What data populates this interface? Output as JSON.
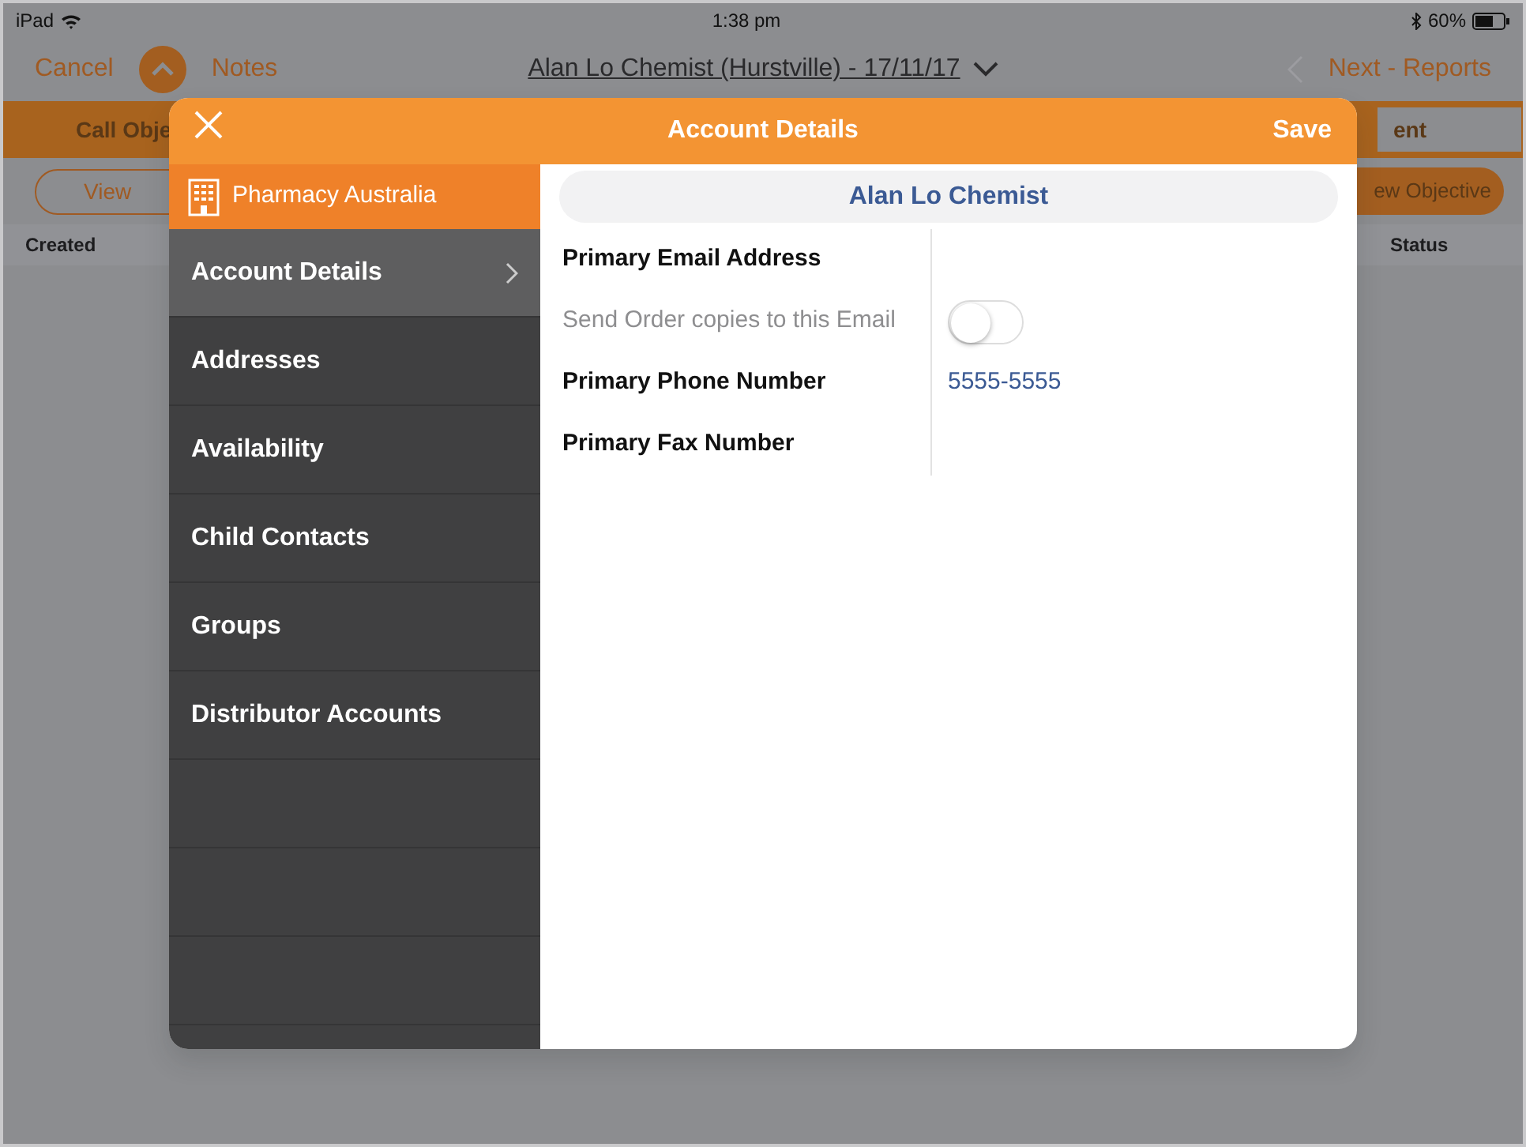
{
  "status_bar": {
    "device": "iPad",
    "time": "1:38 pm",
    "battery": "60%"
  },
  "nav": {
    "cancel": "Cancel",
    "notes": "Notes",
    "title": "Alan Lo Chemist (Hurstville) - 17/11/17",
    "next": "Next - Reports"
  },
  "tabs": [
    {
      "label": "Call Obje",
      "selected": true
    },
    {
      "label": "ent",
      "selected": false
    }
  ],
  "toolbar": {
    "view": "View",
    "new_objective": "ew Objective"
  },
  "table": {
    "columns": [
      "Created",
      "Status"
    ]
  },
  "modal": {
    "title": "Account Details",
    "save": "Save",
    "sidebar": {
      "header": "Pharmacy Australia",
      "items": [
        {
          "label": "Account Details",
          "selected": true
        },
        {
          "label": "Addresses",
          "selected": false
        },
        {
          "label": "Availability",
          "selected": false
        },
        {
          "label": "Child Contacts",
          "selected": false
        },
        {
          "label": "Groups",
          "selected": false
        },
        {
          "label": "Distributor Accounts",
          "selected": false
        }
      ]
    },
    "account_name": "Alan Lo Chemist",
    "fields": [
      {
        "kind": "text",
        "label": "Primary Email Address",
        "disabled": false
      },
      {
        "kind": "toggle",
        "label": "Send Order copies to this Email",
        "on": false,
        "disabled": true
      },
      {
        "kind": "text",
        "label": "Primary Phone Number",
        "value": "5555-5555",
        "disabled": false
      },
      {
        "kind": "text",
        "label": "Primary Fax Number",
        "disabled": false
      }
    ]
  }
}
